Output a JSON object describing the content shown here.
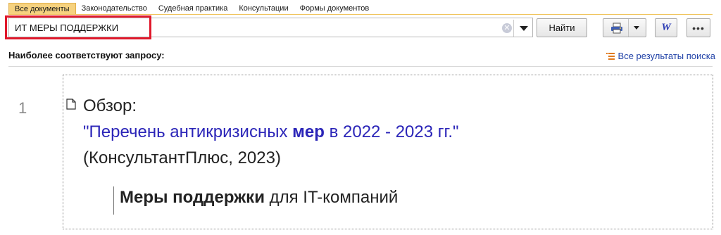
{
  "tabs": [
    {
      "label": "Все документы",
      "active": true
    },
    {
      "label": "Законодательство",
      "active": false
    },
    {
      "label": "Судебная практика",
      "active": false
    },
    {
      "label": "Консультации",
      "active": false
    },
    {
      "label": "Формы документов",
      "active": false
    }
  ],
  "search": {
    "value": "ИТ МЕРЫ ПОДДЕРЖКИ",
    "find_label": "Найти",
    "clear_icon": "clear-icon",
    "dropdown_icon": "chevron-down-icon"
  },
  "toolbar": {
    "print_icon": "printer-icon",
    "word_label": "W",
    "more_label": "•••"
  },
  "results": {
    "header": "Наиболее соответствуют запросу:",
    "all_results_label": "Все результаты поиска",
    "items": [
      {
        "number": "1",
        "type_label": "Обзор:",
        "title_before": "\"Перечень антикризисных ",
        "title_bold": "мер",
        "title_after": " в 2022 - 2023 гг.\"",
        "source": "(КонсультантПлюс, 2023)",
        "snippet_bold": "Меры поддержки",
        "snippet_rest": " для IT-компаний"
      }
    ]
  },
  "colors": {
    "accent_tab": "#f6d27f",
    "highlight": "#e0182b",
    "link": "#2b25b8"
  }
}
